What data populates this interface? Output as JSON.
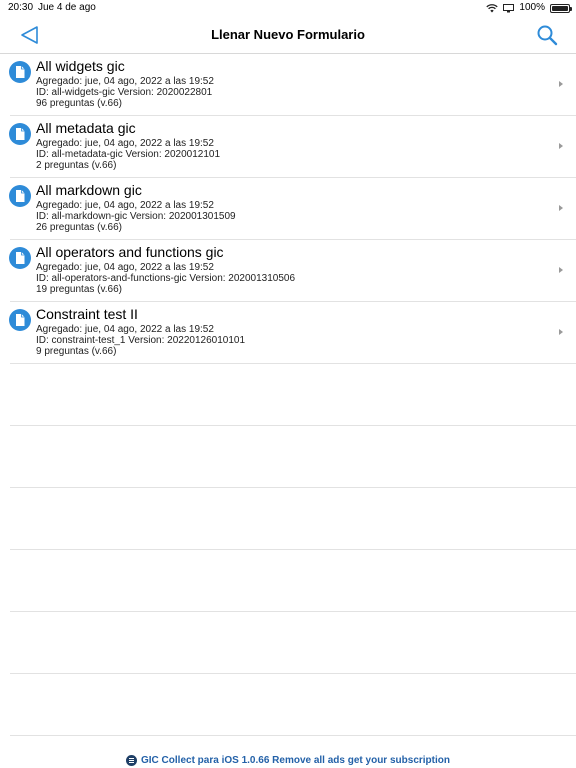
{
  "status_bar": {
    "time": "20:30",
    "date": "Jue 4 de ago",
    "battery": "100%",
    "battery_level": 1.0
  },
  "nav": {
    "title": "Llenar Nuevo Formulario",
    "back_icon": "back-triangle-icon",
    "search_icon": "search-icon"
  },
  "forms": [
    {
      "title": "All widgets gic",
      "added": "Agregado: jue, 04 ago, 2022 a las 19:52",
      "id_version": "ID: all-widgets-gic Version: 2020022801",
      "questions": "96 preguntas (v.66)"
    },
    {
      "title": "All metadata gic",
      "added": "Agregado: jue, 04 ago, 2022 a las 19:52",
      "id_version": "ID: all-metadata-gic Version: 2020012101",
      "questions": "2 preguntas (v.66)"
    },
    {
      "title": "All markdown gic",
      "added": "Agregado: jue, 04 ago, 2022 a las 19:52",
      "id_version": "ID: all-markdown-gic Version: 202001301509",
      "questions": "26 preguntas (v.66)"
    },
    {
      "title": "All operators and functions gic",
      "added": "Agregado: jue, 04 ago, 2022 a las 19:52",
      "id_version": "ID: all-operators-and-functions-gic Version: 202001310506",
      "questions": "19 preguntas (v.66)"
    },
    {
      "title": "Constraint test II",
      "added": "Agregado: jue, 04 ago, 2022 a las 19:52",
      "id_version": "ID: constraint-test_1 Version: 20220126010101",
      "questions": "9 preguntas (v.66)"
    }
  ],
  "footer": {
    "text": "GIC Collect para iOS 1.0.66 Remove all ads get your subscription"
  },
  "colors": {
    "accent": "#2e8bd8",
    "footer_text": "#2361a8"
  }
}
